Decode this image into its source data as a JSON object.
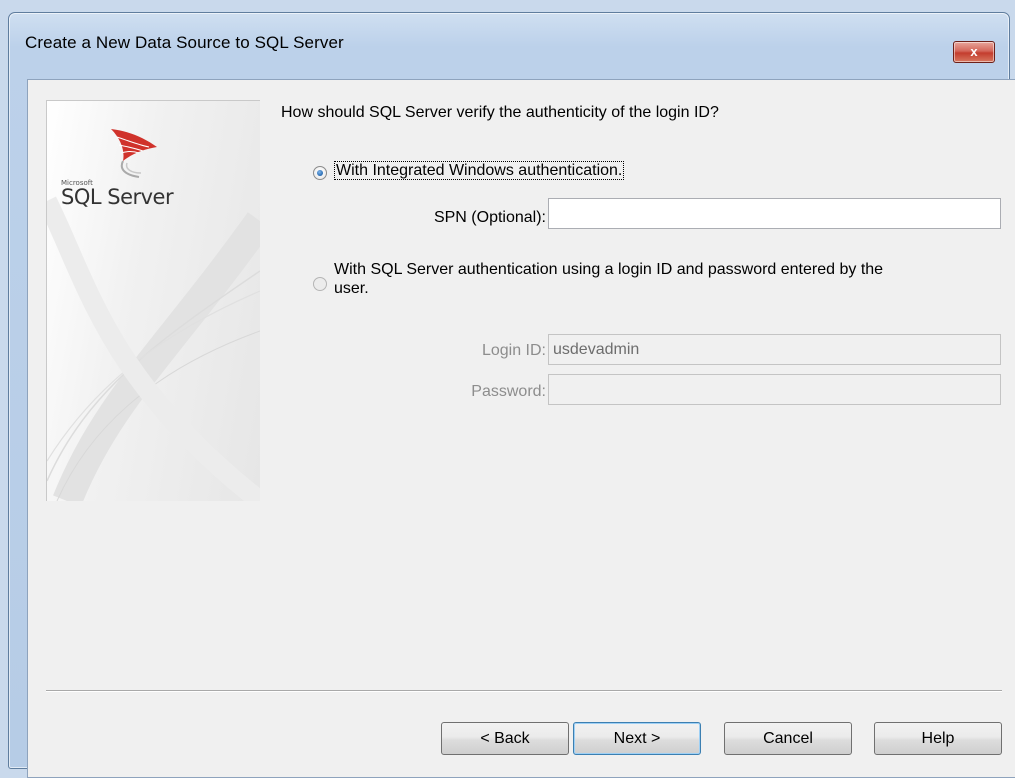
{
  "window": {
    "title": "Create a New Data Source to SQL Server",
    "close_glyph": "x"
  },
  "banner": {
    "logo_icon": "sql-server-logo-icon",
    "microsoft_label": "Microsoft",
    "product_label": "SQL Server"
  },
  "question": "How should SQL Server verify the authenticity of the login ID?",
  "options": {
    "windows_auth": {
      "label": "With Integrated Windows authentication.",
      "selected": true
    },
    "spn": {
      "label": "SPN (Optional):",
      "value": ""
    },
    "sql_auth": {
      "label_line1": "With SQL Server authentication using a login ID and password entered by the",
      "label_line2": "user.",
      "selected": false
    },
    "login": {
      "label": "Login ID:",
      "value": "usdevadmin",
      "enabled": false
    },
    "password": {
      "label": "Password:",
      "value": "",
      "enabled": false
    }
  },
  "buttons": {
    "back": "< Back",
    "next": "Next >",
    "cancel": "Cancel",
    "help": "Help"
  },
  "colors": {
    "title_bar": "#bcd1ea",
    "client_bg": "#f0f0f0",
    "close_button": "#c43d2e"
  }
}
